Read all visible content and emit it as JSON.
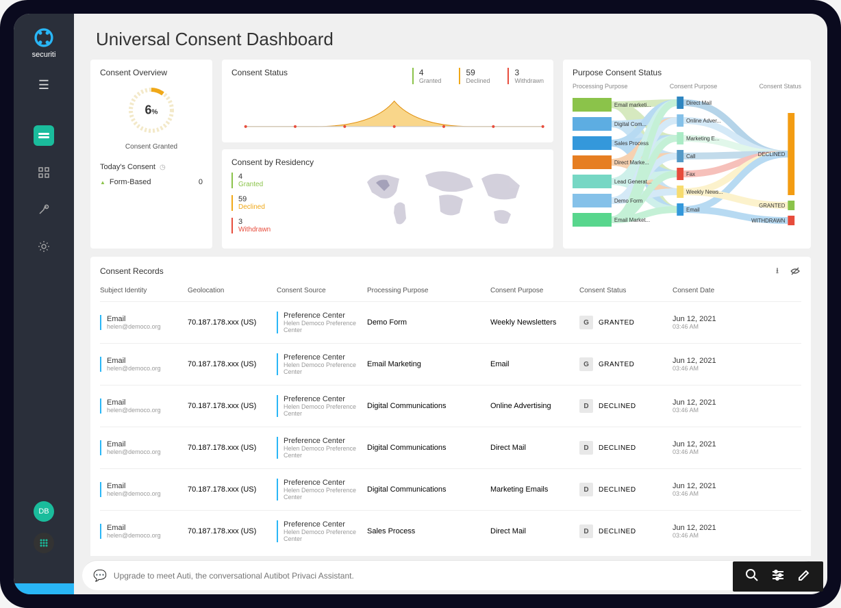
{
  "brand": {
    "name": "securiti"
  },
  "page": {
    "title": "Universal Consent Dashboard"
  },
  "sidebar": {
    "avatar_initials": "DB"
  },
  "overview": {
    "title": "Consent Overview",
    "percent": "6",
    "percent_suffix": "%",
    "gauge_label": "Consent Granted",
    "today_title": "Today's Consent",
    "today_item_label": "Form-Based",
    "today_item_value": "0"
  },
  "status": {
    "title": "Consent Status",
    "metrics": [
      {
        "value": "4",
        "label": "Granted",
        "cls": "sm-granted"
      },
      {
        "value": "59",
        "label": "Declined",
        "cls": "sm-declined"
      },
      {
        "value": "3",
        "label": "Withdrawn",
        "cls": "sm-withdrawn"
      }
    ]
  },
  "residency": {
    "title": "Consent by Residency",
    "metrics": [
      {
        "value": "4",
        "label": "Granted",
        "border": "#8bc34a",
        "lblcls": "lbl-granted"
      },
      {
        "value": "59",
        "label": "Declined",
        "border": "#f0a818",
        "lblcls": "lbl-declined"
      },
      {
        "value": "3",
        "label": "Withdrawn",
        "border": "#e74c3c",
        "lblcls": "lbl-withdrawn"
      }
    ]
  },
  "sankey": {
    "title": "Purpose Consent Status",
    "cols": [
      "Processing Purpose",
      "Consent Purpose",
      "Consent Status"
    ],
    "left": [
      {
        "label": "Email marketi...",
        "color": "#8bc34a"
      },
      {
        "label": "Digital Com...",
        "color": "#5dade2"
      },
      {
        "label": "Sales Process",
        "color": "#3498db"
      },
      {
        "label": "Direct Marke...",
        "color": "#e67e22"
      },
      {
        "label": "Lead Generat...",
        "color": "#76d7c4"
      },
      {
        "label": "Demo Form",
        "color": "#85c1e9"
      },
      {
        "label": "Email Market...",
        "color": "#58d68d"
      }
    ],
    "middle": [
      {
        "label": "Direct Mail",
        "color": "#2e86c1"
      },
      {
        "label": "Online Adver...",
        "color": "#85c1e9"
      },
      {
        "label": "Marketing E...",
        "color": "#abebc6"
      },
      {
        "label": "Call",
        "color": "#5499c7"
      },
      {
        "label": "Fax",
        "color": "#e74c3c"
      },
      {
        "label": "Weekly News...",
        "color": "#f7dc6f"
      },
      {
        "label": "Email",
        "color": "#3498db"
      }
    ],
    "right": [
      {
        "label": "DECLINED",
        "color": "#f39c12"
      },
      {
        "label": "GRANTED",
        "color": "#8bc34a"
      },
      {
        "label": "WITHDRAWN",
        "color": "#e74c3c"
      }
    ]
  },
  "records": {
    "title": "Consent Records",
    "columns": {
      "si": "Subject Identity",
      "geo": "Geolocation",
      "src": "Consent Source",
      "pp": "Processing Purpose",
      "cp": "Consent Purpose",
      "cs": "Consent Status",
      "cd": "Consent Date"
    },
    "rows": [
      {
        "si_top": "Email",
        "si_sub": "helen@democo.org",
        "geo": "70.187.178.xxx (US)",
        "src_top": "Preference Center",
        "src_sub": "Helen Democo Preference Center",
        "pp": "Demo Form",
        "cp": "Weekly Newsletters",
        "cs_letter": "G",
        "cs_text": "GRANTED",
        "cd_top": "Jun 12, 2021",
        "cd_sub": "03:46 AM"
      },
      {
        "si_top": "Email",
        "si_sub": "helen@democo.org",
        "geo": "70.187.178.xxx (US)",
        "src_top": "Preference Center",
        "src_sub": "Helen Democo Preference Center",
        "pp": "Email Marketing",
        "cp": "Email",
        "cs_letter": "G",
        "cs_text": "GRANTED",
        "cd_top": "Jun 12, 2021",
        "cd_sub": "03:46 AM"
      },
      {
        "si_top": "Email",
        "si_sub": "helen@democo.org",
        "geo": "70.187.178.xxx (US)",
        "src_top": "Preference Center",
        "src_sub": "Helen Democo Preference Center",
        "pp": "Digital Communications",
        "cp": "Online Advertising",
        "cs_letter": "D",
        "cs_text": "DECLINED",
        "cd_top": "Jun 12, 2021",
        "cd_sub": "03:46 AM"
      },
      {
        "si_top": "Email",
        "si_sub": "helen@democo.org",
        "geo": "70.187.178.xxx (US)",
        "src_top": "Preference Center",
        "src_sub": "Helen Democo Preference Center",
        "pp": "Digital Communications",
        "cp": "Direct Mail",
        "cs_letter": "D",
        "cs_text": "DECLINED",
        "cd_top": "Jun 12, 2021",
        "cd_sub": "03:46 AM"
      },
      {
        "si_top": "Email",
        "si_sub": "helen@democo.org",
        "geo": "70.187.178.xxx (US)",
        "src_top": "Preference Center",
        "src_sub": "Helen Democo Preference Center",
        "pp": "Digital Communications",
        "cp": "Marketing Emails",
        "cs_letter": "D",
        "cs_text": "DECLINED",
        "cd_top": "Jun 12, 2021",
        "cd_sub": "03:46 AM"
      },
      {
        "si_top": "Email",
        "si_sub": "helen@democo.org",
        "geo": "70.187.178.xxx (US)",
        "src_top": "Preference Center",
        "src_sub": "Helen Democo Preference Center",
        "pp": "Sales Process",
        "cp": "Direct Mail",
        "cs_letter": "D",
        "cs_text": "DECLINED",
        "cd_top": "Jun 12, 2021",
        "cd_sub": "03:46 AM"
      }
    ]
  },
  "chat": {
    "placeholder": "Upgrade to meet Auti, the conversational Autibot Privaci Assistant."
  }
}
